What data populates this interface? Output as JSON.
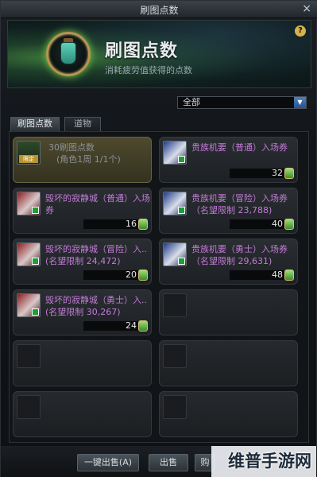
{
  "window": {
    "title": "刷图点数",
    "close_glyph": "×"
  },
  "banner": {
    "title": "刷图点数",
    "subtitle": "消耗疲劳值获得的点数",
    "help_glyph": "?"
  },
  "filter": {
    "selected": "全部",
    "arrow_glyph": "▼"
  },
  "tabs": [
    {
      "label": "刷图点数",
      "active": true
    },
    {
      "label": "道物",
      "active": false
    }
  ],
  "items": [
    {
      "name": "30刷图点数",
      "desc": "(角色1周 1/1个)",
      "cost": "",
      "icon": "potion-icon",
      "tag": "限定"
    },
    {
      "name": "贵族机要（普通）入场券",
      "desc": "",
      "cost": "32",
      "icon": "ticket-blue-icon"
    },
    {
      "name": "毁坏的寂静城（普通）入场券",
      "desc": "",
      "cost": "16",
      "icon": "ticket-red-icon"
    },
    {
      "name": "贵族机要（冒险）入场券（名望限制 23,788)",
      "desc": "",
      "cost": "40",
      "icon": "ticket-blue-icon"
    },
    {
      "name": "毁坏的寂静城（冒险）入..(名望限制 24,472)",
      "desc": "",
      "cost": "20",
      "icon": "ticket-red-icon"
    },
    {
      "name": "贵族机要（勇士）入场券（名望限制 29,631)",
      "desc": "",
      "cost": "48",
      "icon": "ticket-blue-icon"
    },
    {
      "name": "毁坏的寂静城（勇士）入..(名望限制 30,267)",
      "desc": "",
      "cost": "24",
      "icon": "ticket-red-icon"
    }
  ],
  "buttons": {
    "sell_all": "一键出售(A)",
    "sell": "出售",
    "buy": "购"
  },
  "watermark": "维普手游网",
  "colors": {
    "item_purple": "#c27bd6",
    "item_white": "#e4e8ec",
    "coin_green": "#3f8a2a",
    "accent_blue": "#2a5392"
  }
}
